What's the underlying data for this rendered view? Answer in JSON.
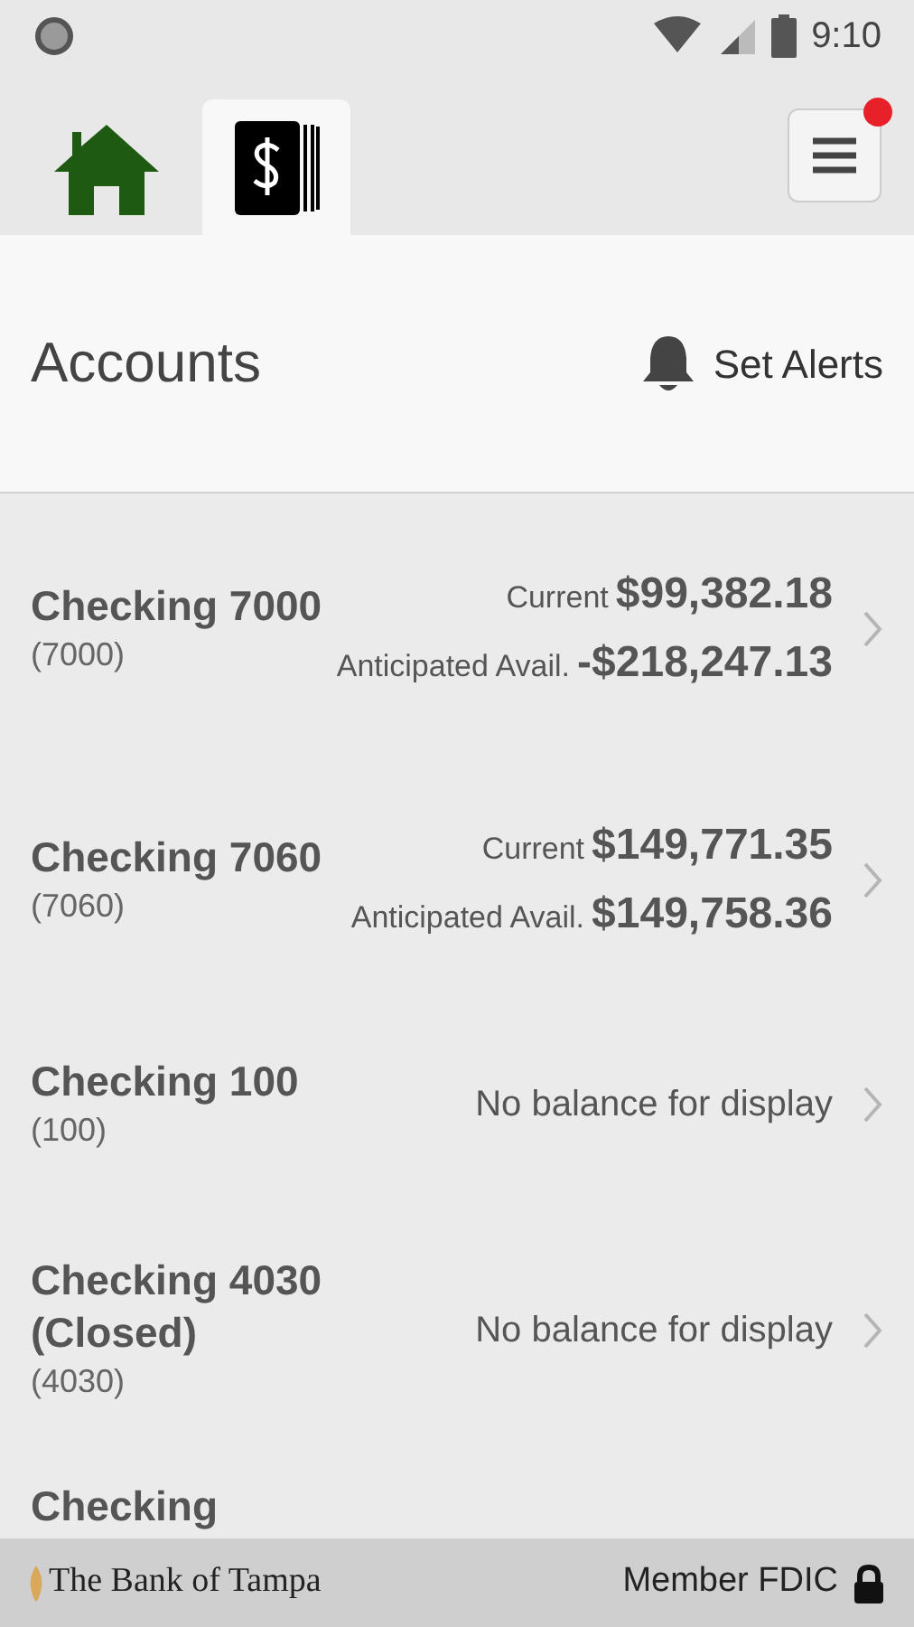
{
  "status_bar": {
    "time": "9:10"
  },
  "nav_tabs": [
    {
      "kind": "home",
      "selected": false
    },
    {
      "kind": "accounts",
      "selected": true
    }
  ],
  "menu": {
    "notification": true
  },
  "header": {
    "title": "Accounts",
    "alerts_label": "Set Alerts"
  },
  "accounts": [
    {
      "kind": "balance",
      "name": "Checking 7000",
      "number": "(7000)",
      "current_label": "Current",
      "current": "$99,382.18",
      "anticipated_label": "Anticipated Avail.",
      "anticipated": "-$218,247.13"
    },
    {
      "kind": "balance",
      "name": "Checking 7060",
      "number": "(7060)",
      "current_label": "Current",
      "current": "$149,771.35",
      "anticipated_label": "Anticipated Avail.",
      "anticipated": "$149,758.36"
    },
    {
      "kind": "no_balance",
      "name": "Checking 100",
      "number": "(100)",
      "message": "No balance for display"
    },
    {
      "kind": "no_balance",
      "name": "Checking 4030 (Closed)",
      "number": "(4030)",
      "message": "No balance for display"
    },
    {
      "kind": "partial",
      "name": "Checking"
    }
  ],
  "footer": {
    "bank": "The Bank of Tampa",
    "member": "Member FDIC"
  }
}
